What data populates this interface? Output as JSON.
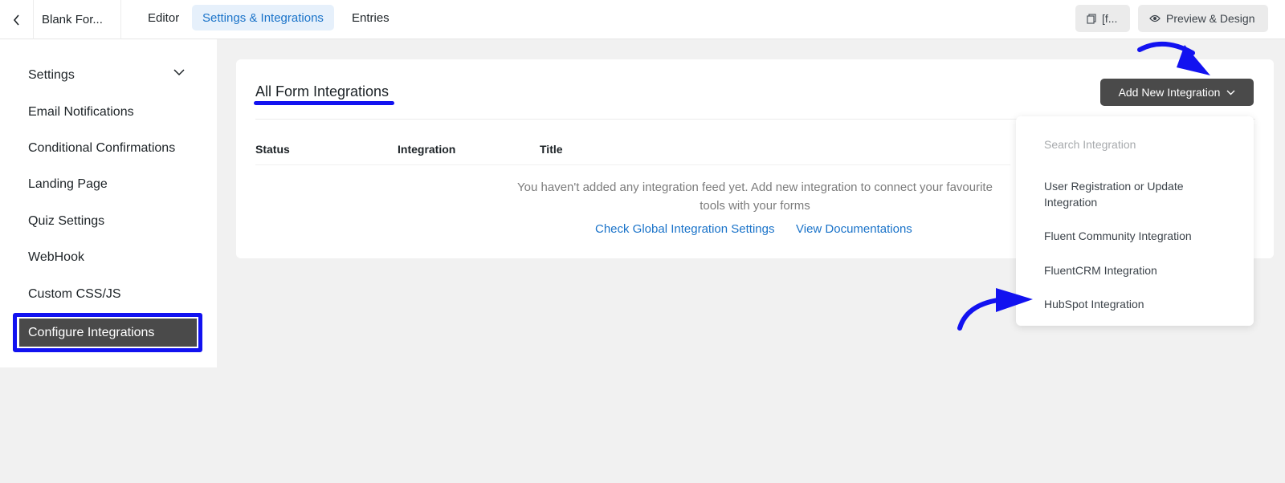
{
  "header": {
    "form_name": "Blank For...",
    "tabs": [
      {
        "label": "Editor"
      },
      {
        "label": "Settings & Integrations"
      },
      {
        "label": "Entries"
      }
    ],
    "shortcode_label": "[f...",
    "preview_label": "Preview & Design"
  },
  "sidebar": {
    "items": [
      {
        "label": "Settings"
      },
      {
        "label": "Email Notifications"
      },
      {
        "label": "Conditional Confirmations"
      },
      {
        "label": "Landing Page"
      },
      {
        "label": "Quiz Settings"
      },
      {
        "label": "WebHook"
      },
      {
        "label": "Custom CSS/JS"
      },
      {
        "label": "Configure Integrations"
      }
    ]
  },
  "main": {
    "title": "All Form Integrations",
    "add_button_label": "Add New Integration",
    "columns": [
      "Status",
      "Integration",
      "Title"
    ],
    "empty_message": "You haven't added any integration feed yet. Add new integration to connect your favourite tools with your forms",
    "links": [
      "Check Global Integration Settings",
      "View Documentations"
    ]
  },
  "dropdown": {
    "search_placeholder": "Search Integration",
    "items": [
      {
        "label": "User Registration or Update Integration"
      },
      {
        "label": "Fluent Community Integration"
      },
      {
        "label": "FluentCRM Integration"
      },
      {
        "label": "HubSpot Integration"
      }
    ]
  },
  "colors": {
    "accent": "#1a73c9",
    "annotation": "#1212f0",
    "dark_button": "#4a4a4a"
  }
}
